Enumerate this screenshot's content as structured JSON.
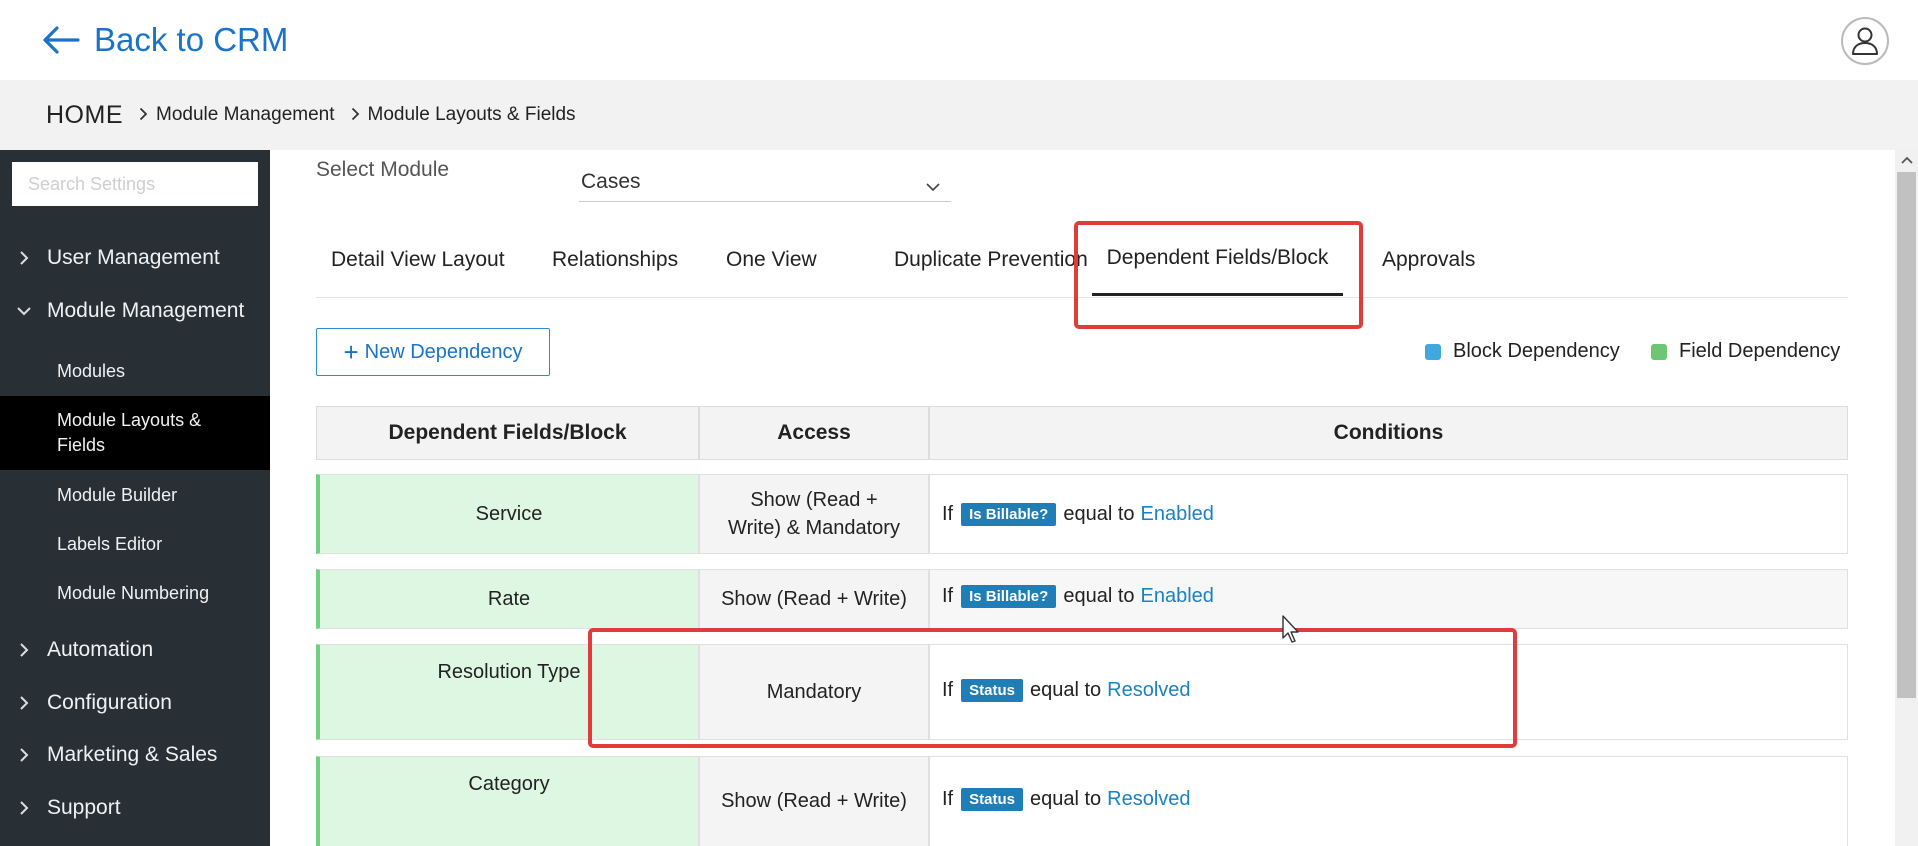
{
  "header": {
    "back_label": "Back to CRM"
  },
  "breadcrumb": {
    "home": "HOME",
    "items": [
      "Module Management",
      "Module Layouts & Fields"
    ]
  },
  "sidebar": {
    "search_placeholder": "Search Settings",
    "sections": [
      {
        "label": "User Management",
        "expanded": false
      },
      {
        "label": "Module Management",
        "expanded": true
      },
      {
        "label": "Automation",
        "expanded": false
      },
      {
        "label": "Configuration",
        "expanded": false
      },
      {
        "label": "Marketing & Sales",
        "expanded": false
      },
      {
        "label": "Support",
        "expanded": false
      }
    ],
    "sub_items": [
      {
        "label": "Modules",
        "active": false
      },
      {
        "label": "Module Layouts & Fields",
        "active": true
      },
      {
        "label": "Module Builder",
        "active": false
      },
      {
        "label": "Labels Editor",
        "active": false
      },
      {
        "label": "Module Numbering",
        "active": false
      }
    ]
  },
  "module_select": {
    "label": "Select Module",
    "value": "Cases"
  },
  "tabs": [
    {
      "label": "Detail View Layout",
      "active": false
    },
    {
      "label": "Relationships",
      "active": false
    },
    {
      "label": "One View",
      "active": false
    },
    {
      "label": "Duplicate Prevention",
      "active": false
    },
    {
      "label": "Dependent Fields/Block",
      "active": true
    },
    {
      "label": "Approvals",
      "active": false
    }
  ],
  "new_dependency_label": "New Dependency",
  "legend": [
    {
      "label": "Block Dependency",
      "color": "#3fa8dc"
    },
    {
      "label": "Field Dependency",
      "color": "#6cc673"
    }
  ],
  "table": {
    "headers": [
      "Dependent Fields/Block",
      "Access",
      "Conditions"
    ],
    "rows": [
      {
        "name": "Service",
        "access": "Show (Read + Write) & Mandatory",
        "cond_if": "If",
        "field": "Is Billable?",
        "operator": "equal to",
        "value": "Enabled"
      },
      {
        "name": "Rate",
        "access": "Show (Read + Write)",
        "cond_if": "If",
        "field": "Is Billable?",
        "operator": "equal to",
        "value": "Enabled"
      },
      {
        "name": "Resolution Type",
        "access": "Mandatory",
        "cond_if": "If",
        "field": "Status",
        "operator": "equal to",
        "value": "Resolved"
      },
      {
        "name": "Category",
        "access": "Show (Read + Write)",
        "cond_if": "If",
        "field": "Status",
        "operator": "equal to",
        "value": "Resolved"
      }
    ]
  },
  "colors": {
    "accent": "#1a73c9",
    "sidebar_bg": "#283036",
    "highlight": "#e03c3c",
    "tag_bg": "#1f7eb5",
    "field_dep_bg": "#def7e2"
  }
}
